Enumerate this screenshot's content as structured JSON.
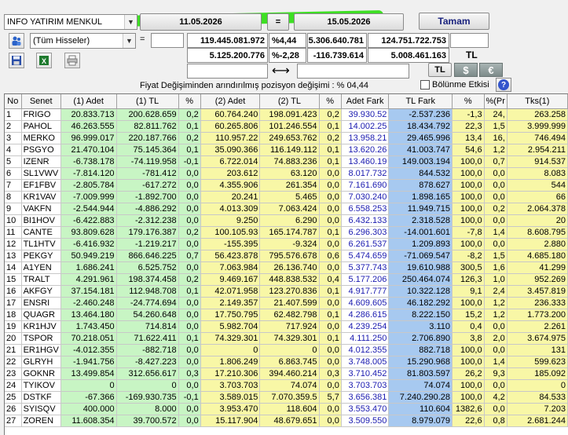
{
  "toolbar": {
    "broker": "INFO YATIRIM MENKUL",
    "date_start": "11.05.2026",
    "equals": "=",
    "date_end": "15.05.2026",
    "ok_label": "Tamam",
    "stock_filter": "(Tüm Hisseler)",
    "eq2": "="
  },
  "summary": {
    "row1": {
      "v1": "119.445.081.972",
      "p1": "%4,44",
      "v2": "5.306.640.781",
      "v3": "124.751.722.753"
    },
    "row2": {
      "v1": "5.125.200.776",
      "p1": "%-2,28",
      "v2": "-116.739.614",
      "v3": "5.008.461.163",
      "unit": "TL"
    },
    "arrow": "⟷",
    "cur_tl": "TL",
    "cur_usd": "$",
    "cur_eur": "€"
  },
  "note": "Fiyat Değişiminden arındırılmış pozisyon değişimi : % 04,44",
  "split_label": "Bölünme Etkisi",
  "help": "?",
  "icons": [
    "people-icon",
    "save-icon",
    "excel-icon",
    "print-icon"
  ],
  "columns": [
    "No",
    "Senet",
    "(1) Adet",
    "(1) TL",
    "%",
    "(2) Adet",
    "(2) TL",
    "%",
    "Adet Fark",
    "TL Fark",
    "%",
    "%(Pr",
    "Tks(1)"
  ],
  "rows": [
    [
      "1",
      "FRIGO",
      "20.833.713",
      "200.628.659",
      "0,2",
      "60.764.240",
      "198.091.423",
      "0,2",
      "39.930.52",
      "-2.537.236",
      "-1,3",
      "24,",
      "263.258"
    ],
    [
      "2",
      "PAHOL",
      "46.263.555",
      "82.811.762",
      "0,1",
      "60.265.806",
      "101.246.554",
      "0,1",
      "14.002.25",
      "18.434.792",
      "22,3",
      "1,5",
      "3.999.999"
    ],
    [
      "3",
      "MERKO",
      "96.999.017",
      "220.187.766",
      "0,2",
      "110.957.22",
      "249.653.762",
      "0,2",
      "13.958.21",
      "29.465.996",
      "13,4",
      "16,",
      "746.494"
    ],
    [
      "4",
      "PSGYO",
      "21.470.104",
      "75.145.364",
      "0,1",
      "35.090.366",
      "116.149.112",
      "0,1",
      "13.620.26",
      "41.003.747",
      "54,6",
      "1,2",
      "2.954.211"
    ],
    [
      "5",
      "IZENR",
      "-6.738.178",
      "-74.119.958",
      "-0,1",
      "6.722.014",
      "74.883.236",
      "0,1",
      "13.460.19",
      "149.003.194",
      "100,0",
      "0,7",
      "914.537"
    ],
    [
      "6",
      "SL1VWV",
      "-7.814.120",
      "-781.412",
      "0,0",
      "203.612",
      "63.120",
      "0,0",
      "8.017.732",
      "844.532",
      "100,0",
      "0,0",
      "8.083"
    ],
    [
      "7",
      "EF1FBV",
      "-2.805.784",
      "-617.272",
      "0,0",
      "4.355.906",
      "261.354",
      "0,0",
      "7.161.690",
      "878.627",
      "100,0",
      "0,0",
      "544"
    ],
    [
      "8",
      "KR1VAV",
      "-7.009.999",
      "-1.892.700",
      "0,0",
      "20.241",
      "5.465",
      "0,0",
      "7.030.240",
      "1.898.165",
      "100,0",
      "0,0",
      "66"
    ],
    [
      "9",
      "VAKFN",
      "-2.544.944",
      "-4.886.292",
      "0,0",
      "4.013.309",
      "7.063.424",
      "0,0",
      "6.558.253",
      "11.949.715",
      "100,0",
      "0,2",
      "2.064.378"
    ],
    [
      "10",
      "BI1HOV",
      "-6.422.883",
      "-2.312.238",
      "0,0",
      "9.250",
      "6.290",
      "0,0",
      "6.432.133",
      "2.318.528",
      "100,0",
      "0,0",
      "20"
    ],
    [
      "11",
      "CANTE",
      "93.809.628",
      "179.176.387",
      "0,2",
      "100.105.93",
      "165.174.787",
      "0,1",
      "6.296.303",
      "-14.001.601",
      "-7,8",
      "1,4",
      "8.608.795"
    ],
    [
      "12",
      "TL1HTV",
      "-6.416.932",
      "-1.219.217",
      "0,0",
      "-155.395",
      "-9.324",
      "0,0",
      "6.261.537",
      "1.209.893",
      "100,0",
      "0,0",
      "2.880"
    ],
    [
      "13",
      "PEKGY",
      "50.949.219",
      "866.646.225",
      "0,7",
      "56.423.878",
      "795.576.678",
      "0,6",
      "5.474.659",
      "-71.069.547",
      "-8,2",
      "1,5",
      "4.685.180"
    ],
    [
      "14",
      "A1YEN",
      "1.686.241",
      "6.525.752",
      "0,0",
      "7.063.984",
      "26.136.740",
      "0,0",
      "5.377.743",
      "19.610.988",
      "300,5",
      "1,6",
      "41.299"
    ],
    [
      "15",
      "TRALT",
      "4.291.961",
      "198.374.458",
      "0,2",
      "9.469.167",
      "448.838.532",
      "0,4",
      "5.177.206",
      "250.464.074",
      "126,3",
      "1,0",
      "952.269"
    ],
    [
      "16",
      "AKFGY",
      "37.154.181",
      "112.948.708",
      "0,1",
      "42.071.958",
      "123.270.836",
      "0,1",
      "4.917.777",
      "10.322.128",
      "9,1",
      "2,4",
      "3.457.819"
    ],
    [
      "17",
      "ENSRI",
      "-2.460.248",
      "-24.774.694",
      "0,0",
      "2.149.357",
      "21.407.599",
      "0,0",
      "4.609.605",
      "46.182.292",
      "100,0",
      "1,2",
      "236.333"
    ],
    [
      "18",
      "QUAGR",
      "13.464.180",
      "54.260.648",
      "0,0",
      "17.750.795",
      "62.482.798",
      "0,1",
      "4.286.615",
      "8.222.150",
      "15,2",
      "1,2",
      "1.773.200"
    ],
    [
      "19",
      "KR1HJV",
      "1.743.450",
      "714.814",
      "0,0",
      "5.982.704",
      "717.924",
      "0,0",
      "4.239.254",
      "3.110",
      "0,4",
      "0,0",
      "2.261"
    ],
    [
      "20",
      "TSPOR",
      "70.218.051",
      "71.622.411",
      "0,1",
      "74.329.301",
      "74.329.301",
      "0,1",
      "4.111.250",
      "2.706.890",
      "3,8",
      "2,0",
      "3.674.975"
    ],
    [
      "21",
      "ER1HGV",
      "-4.012.355",
      "-882.718",
      "0,0",
      "0",
      "0",
      "0,0",
      "4.012.355",
      "882.718",
      "100,0",
      "0,0",
      "131"
    ],
    [
      "22",
      "GLRYH",
      "-1.941.756",
      "-8.427.223",
      "0,0",
      "1.806.249",
      "6.863.745",
      "0,0",
      "3.748.005",
      "15.290.968",
      "100,0",
      "1,4",
      "599.623"
    ],
    [
      "23",
      "GOKNR",
      "13.499.854",
      "312.656.617",
      "0,3",
      "17.210.306",
      "394.460.214",
      "0,3",
      "3.710.452",
      "81.803.597",
      "26,2",
      "9,3",
      "185.092"
    ],
    [
      "24",
      "TYIKOV",
      "0",
      "0",
      "0,0",
      "3.703.703",
      "74.074",
      "0,0",
      "3.703.703",
      "74.074",
      "100,0",
      "0,0",
      "0"
    ],
    [
      "25",
      "DSTKF",
      "-67.366",
      "-169.930.735",
      "-0,1",
      "3.589.015",
      "7.070.359.5",
      "5,7",
      "3.656.381",
      "7.240.290.28",
      "100,0",
      "4,2",
      "84.533"
    ],
    [
      "26",
      "SYISQV",
      "400.000",
      "8.000",
      "0,0",
      "3.953.470",
      "118.604",
      "0,0",
      "3.553.470",
      "110.604",
      "1382,6",
      "0,0",
      "7.203"
    ],
    [
      "27",
      "ZOREN",
      "11.608.354",
      "39.700.572",
      "0,0",
      "15.117.904",
      "48.679.651",
      "0,0",
      "3.509.550",
      "8.979.079",
      "22,6",
      "0,8",
      "2.681.244"
    ]
  ],
  "colors": {
    "green_col": "#c8f5c4",
    "yellow_col": "#f8f7a6",
    "blue_col": "#a7c9f0",
    "fark_text": "#1a1ab0"
  }
}
